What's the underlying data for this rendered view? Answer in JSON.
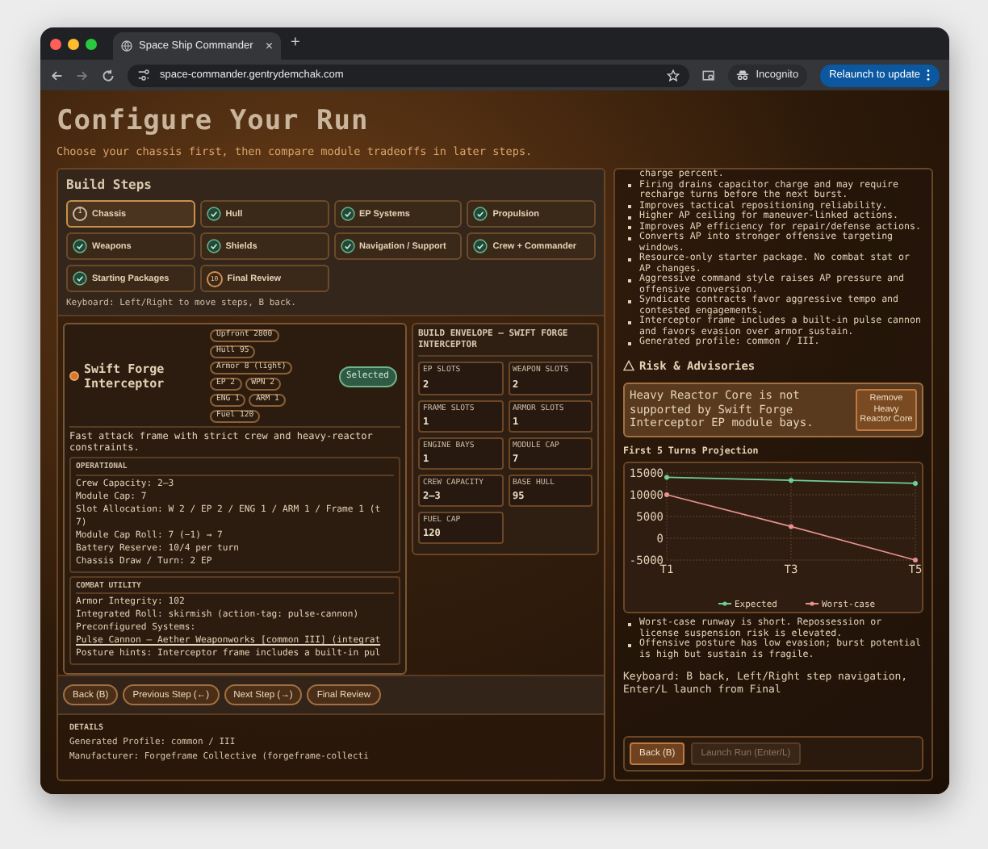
{
  "browser": {
    "tab_title": "Space Ship Commander",
    "tab_close": "×",
    "new_tab": "+",
    "url": "space-commander.gentrydemchak.com",
    "incognito": "Incognito",
    "relaunch": "Relaunch to update"
  },
  "page": {
    "title": "Configure Your Run",
    "subtitle": "Choose your chassis first, then compare module tradeoffs in later steps."
  },
  "build_steps": {
    "title": "Build Steps",
    "hint": "Keyboard: Left/Right to move steps, B back.",
    "steps": [
      {
        "number": "1",
        "label": "Chassis",
        "kind": "number",
        "selected": true
      },
      {
        "label": "Hull",
        "kind": "check",
        "selected": false
      },
      {
        "label": "EP Systems",
        "kind": "check",
        "selected": false
      },
      {
        "label": "Propulsion",
        "kind": "check",
        "selected": false
      },
      {
        "label": "Weapons",
        "kind": "check",
        "selected": false
      },
      {
        "label": "Shields",
        "kind": "check",
        "selected": false
      },
      {
        "label": "Navigation / Support",
        "kind": "check",
        "selected": false
      },
      {
        "label": "Crew + Commander",
        "kind": "check",
        "selected": false
      },
      {
        "label": "Starting Packages",
        "kind": "check",
        "selected": false
      },
      {
        "number": "10",
        "label": "Final Review",
        "kind": "number",
        "selected": false
      }
    ]
  },
  "chassis_card": {
    "name": "Swift Forge Interceptor",
    "selected": true,
    "badge": "Selected",
    "tags": [
      "Upfront 2800",
      "Hull 95",
      "Armor 8 (light)",
      "EP 2",
      "WPN 2",
      "ENG 1",
      "ARM 1",
      "Fuel 120"
    ],
    "description": "Fast attack frame with strict crew and heavy-reactor constraints.",
    "sections": [
      {
        "title": "OPERATIONAL",
        "lines": [
          {
            "text": "Crew Capacity: 2–3",
            "kind": "text"
          },
          {
            "text": "Module Cap: 7",
            "kind": "text"
          },
          {
            "text": "Slot Allocation: W 2 / EP 2 / ENG 1 / ARM 1 / Frame 1 (t",
            "kind": "text"
          },
          {
            "text": "7)",
            "kind": "text"
          },
          {
            "text": "Module Cap Roll: 7 (−1) → 7",
            "kind": "text"
          },
          {
            "text": "Battery Reserve: 10/4 per turn",
            "kind": "text"
          },
          {
            "text": "Chassis Draw / Turn: 2 EP",
            "kind": "text"
          }
        ]
      },
      {
        "title": "COMBAT UTILITY",
        "lines": [
          {
            "text": "Armor Integrity: 102",
            "kind": "text"
          },
          {
            "text": "Integrated Roll: skirmish (action-tag: pulse-cannon)",
            "kind": "text"
          },
          {
            "text": "Preconfigured Systems:",
            "kind": "text"
          },
          {
            "text": "Pulse Cannon — Aether Weaponworks [common III] (integrat",
            "kind": "link"
          },
          {
            "text": "Posture hints: Interceptor frame includes a built-in pul",
            "kind": "text"
          }
        ]
      }
    ]
  },
  "nav_buttons": [
    "Back (B)",
    "Previous Step (←)",
    "Next Step (→)",
    "Final Review"
  ],
  "details": {
    "title": "DETAILS",
    "lines": [
      "Generated Profile: common / III",
      "Manufacturer: Forgeframe Collective (forgeframe-collecti"
    ]
  },
  "envelope": {
    "title": "BUILD ENVELOPE — SWIFT FORGE INTERCEPTOR",
    "stats": [
      {
        "label": "EP SLOTS",
        "value": "2"
      },
      {
        "label": "WEAPON SLOTS",
        "value": "2"
      },
      {
        "label": "FRAME SLOTS",
        "value": "1"
      },
      {
        "label": "ARMOR SLOTS",
        "value": "1"
      },
      {
        "label": "ENGINE BAYS",
        "value": "1"
      },
      {
        "label": "MODULE CAP",
        "value": "7"
      },
      {
        "label": "CREW CAPACITY",
        "value": "2–3"
      },
      {
        "label": "BASE HULL",
        "value": "95"
      },
      {
        "label": "FUEL CAP",
        "value": "120"
      }
    ]
  },
  "summary": {
    "lead": "charge percent.",
    "bullets": [
      "Firing drains capacitor charge and may require recharge turns before the next burst.",
      "Improves tactical repositioning reliability.",
      "Higher AP ceiling for maneuver-linked actions.",
      "Improves AP efficiency for repair/defense actions.",
      "Converts AP into stronger offensive targeting windows.",
      "Resource-only starter package. No combat stat or AP changes.",
      "Aggressive command style raises AP pressure and offensive conversion.",
      "Syndicate contracts favor aggressive tempo and contested engagements.",
      "Interceptor frame includes a built-in pulse cannon and favors evasion over armor sustain.",
      "Generated profile: common / III."
    ]
  },
  "risk": {
    "title": "Risk & Advisories",
    "alert": {
      "text": "Heavy Reactor Core is not supported by Swift Forge Interceptor EP module bays.",
      "action": "Remove Heavy Reactor Core"
    },
    "chart_title": "First 5 Turns Projection",
    "chart_data": {
      "type": "line",
      "categories": [
        "T1",
        "T3",
        "T5"
      ],
      "yticks": [
        -5000,
        0,
        5000,
        10000,
        15000
      ],
      "ylim": [
        -5000,
        15000
      ],
      "grid": true,
      "legend": true,
      "series": [
        {
          "name": "Expected",
          "color": "#6fcf97",
          "marker": "circle",
          "values": [
            14000,
            13300,
            12600
          ]
        },
        {
          "name": "Worst-case",
          "color": "#e8918f",
          "marker": "circle",
          "values": [
            10000,
            2700,
            -5000
          ]
        }
      ]
    },
    "bullets": [
      "Worst-case runway is short. Repossession or license suspension risk is elevated.",
      "Offensive posture has low evasion; burst potential is high but sustain is fragile."
    ],
    "keyboard_hint": "Keyboard: B back, Left/Right step navigation, Enter/L launch from Final",
    "buttons": [
      {
        "label": "Back (B)",
        "disabled": false
      },
      {
        "label": "Launch Run (Enter/L)",
        "disabled": true
      }
    ]
  }
}
